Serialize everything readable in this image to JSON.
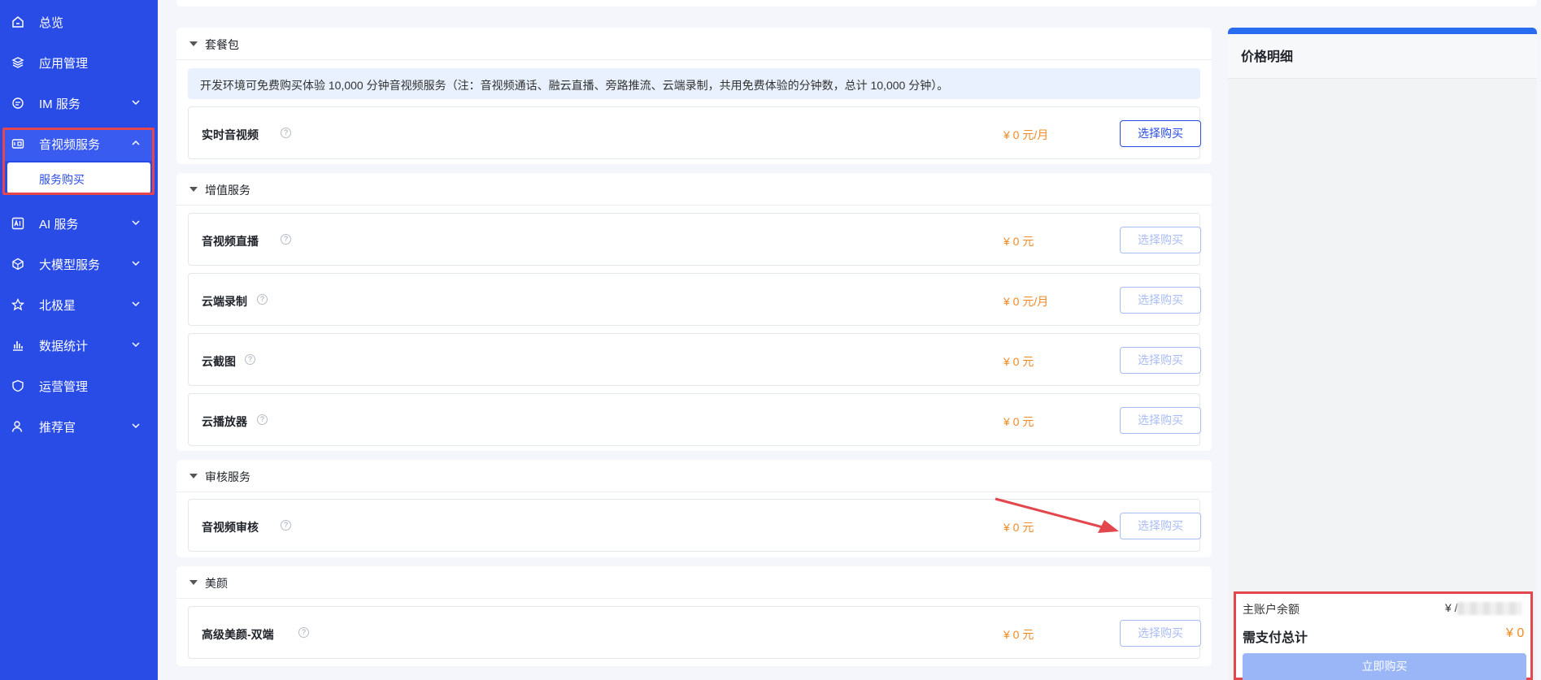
{
  "sidebar": {
    "items": [
      {
        "label": "总览",
        "icon": "home-icon"
      },
      {
        "label": "应用管理",
        "icon": "layers-icon"
      },
      {
        "label": "IM 服务",
        "icon": "chat-icon"
      },
      {
        "label": "音视频服务",
        "icon": "video-icon"
      },
      {
        "label": "AI 服务",
        "icon": "ai-icon"
      },
      {
        "label": "大模型服务",
        "icon": "cube-icon"
      },
      {
        "label": "北极星",
        "icon": "star-icon"
      },
      {
        "label": "数据统计",
        "icon": "bar-chart-icon"
      },
      {
        "label": "运营管理",
        "icon": "shield-icon"
      },
      {
        "label": "推荐官",
        "icon": "user-icon"
      }
    ],
    "sub_item": "服务购买"
  },
  "sections": {
    "package": {
      "title": "套餐包",
      "notice": "开发环境可免费购买体验 10,000 分钟音视频服务（注：音视频通话、融云直播、旁路推流、云端录制，共用免费体验的分钟数，总计 10,000 分钟）。",
      "rows": [
        {
          "name": "实时音视频",
          "price": "¥ 0 元/月",
          "button": "选择购买"
        }
      ]
    },
    "value_added": {
      "title": "增值服务",
      "rows": [
        {
          "name": "音视频直播",
          "price": "¥ 0 元",
          "button": "选择购买"
        },
        {
          "name": "云端录制",
          "price": "¥ 0 元/月",
          "button": "选择购买"
        },
        {
          "name": "云截图",
          "price": "¥ 0 元",
          "button": "选择购买"
        },
        {
          "name": "云播放器",
          "price": "¥ 0 元",
          "button": "选择购买"
        }
      ]
    },
    "review": {
      "title": "审核服务",
      "rows": [
        {
          "name": "音视频审核",
          "price": "¥ 0 元",
          "button": "选择购买"
        }
      ]
    },
    "beauty": {
      "title": "美颜",
      "rows": [
        {
          "name": "高级美颜-双端",
          "price": "¥ 0 元",
          "button": "选择购买"
        }
      ]
    }
  },
  "panel": {
    "title": "价格明细",
    "balance_label": "主账户余额",
    "balance_prefix": "¥ /",
    "total_label": "需支付总计",
    "total_value": "¥ 0",
    "buy_button": "立即购买"
  },
  "help_glyph": "?",
  "colors": {
    "sidebar": "#2a4ce6",
    "accent": "#2a4ce6",
    "price": "#f08a24",
    "highlight": "#e3474d"
  }
}
